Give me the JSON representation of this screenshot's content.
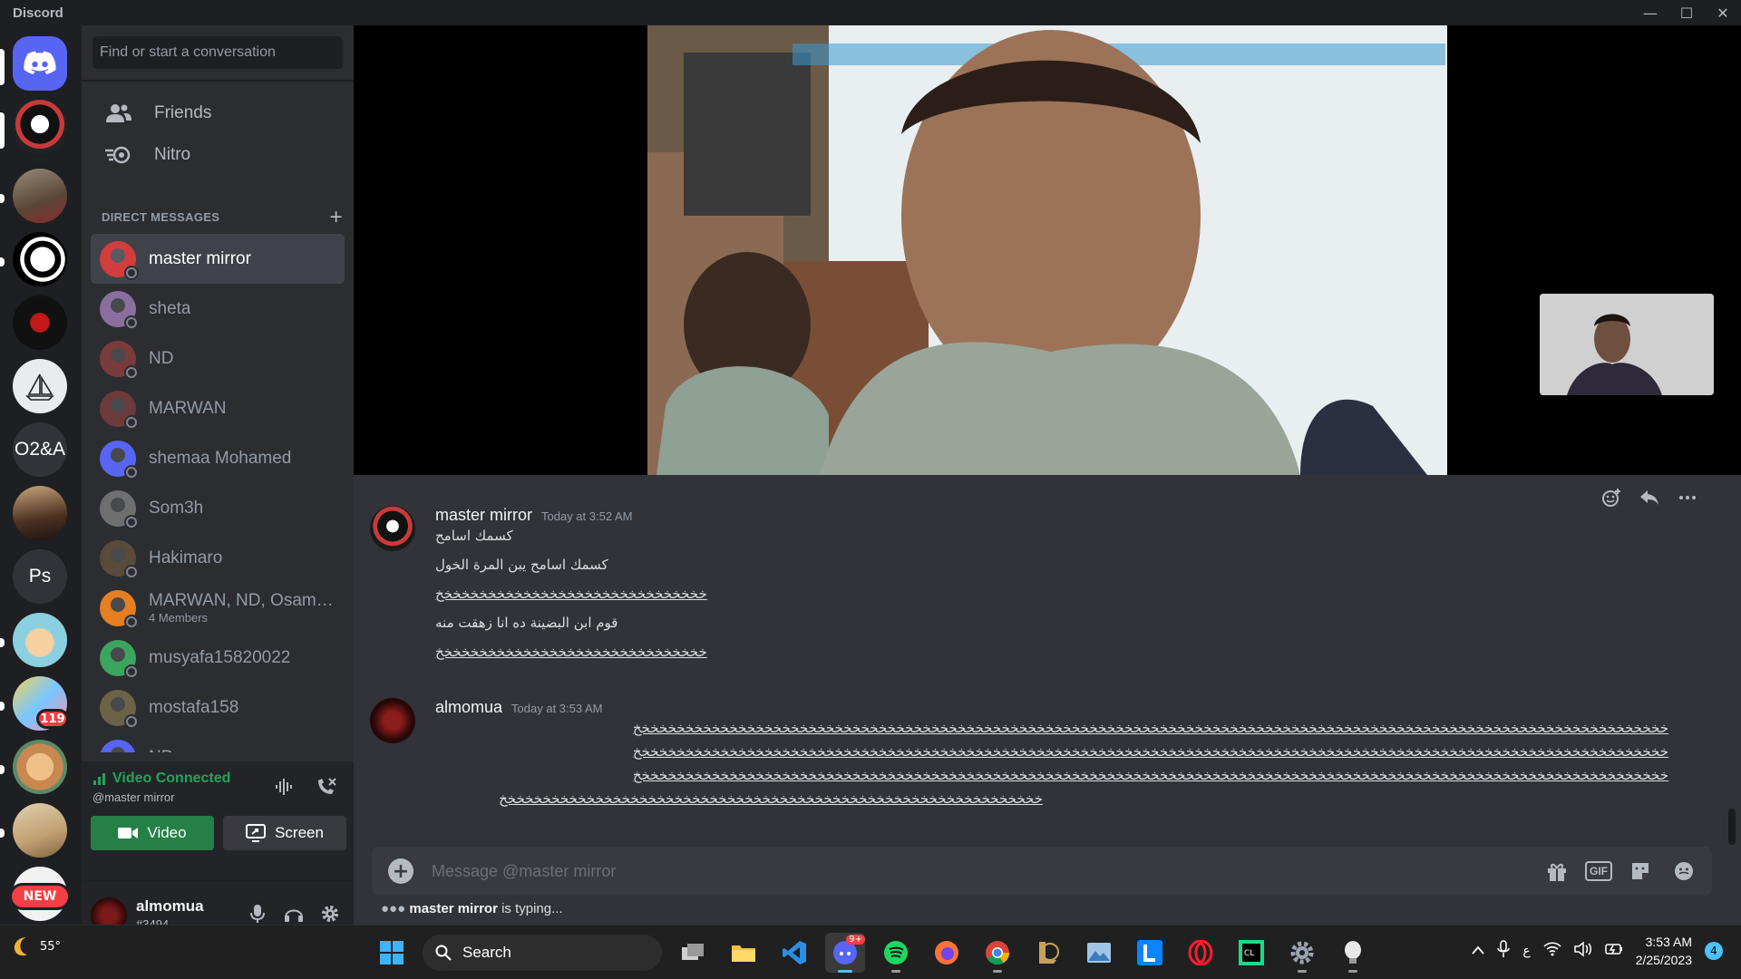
{
  "app": {
    "title": "Discord"
  },
  "window": {
    "minimize": "—",
    "maximize": "☐",
    "close": "✕"
  },
  "servers": [
    {
      "name": "discord-home",
      "label": ""
    },
    {
      "name": "penguin",
      "label": ""
    },
    {
      "name": "s3",
      "label": ""
    },
    {
      "name": "s4",
      "label": ""
    },
    {
      "name": "s5",
      "label": ""
    },
    {
      "name": "s6",
      "label": ""
    },
    {
      "name": "o2a",
      "label": "O2&A"
    },
    {
      "name": "s8",
      "label": ""
    },
    {
      "name": "ps",
      "label": "Ps"
    },
    {
      "name": "s10",
      "label": ""
    },
    {
      "name": "s11",
      "label": ""
    },
    {
      "name": "s12",
      "label": ""
    },
    {
      "name": "s13",
      "label": ""
    },
    {
      "name": "s14",
      "label": ""
    }
  ],
  "badges": {
    "count": "119",
    "new": "NEW"
  },
  "sidebar": {
    "search_placeholder": "Find or start a conversation",
    "friends": "Friends",
    "nitro": "Nitro",
    "dm_header": "DIRECT MESSAGES",
    "dm_add": "+",
    "dms": [
      {
        "name": "master mirror",
        "sub": "",
        "active": true,
        "color": "#d23d3d"
      },
      {
        "name": "sheta",
        "sub": "",
        "color": "#8a6f9e"
      },
      {
        "name": "ND",
        "sub": "",
        "color": "#7a3b3b"
      },
      {
        "name": "MARWAN",
        "sub": "",
        "color": "#6b3a3a"
      },
      {
        "name": "shemaa Mohamed",
        "sub": "",
        "color": "#5865f2"
      },
      {
        "name": "Som3h",
        "sub": "",
        "color": "#6f6f6f"
      },
      {
        "name": "Hakimaro",
        "sub": "",
        "color": "#5a4a3a"
      },
      {
        "name": "MARWAN, ND, Osama...",
        "sub": "4 Members",
        "color": "#e67e22"
      },
      {
        "name": "musyafa15820022",
        "sub": "",
        "color": "#3ba55d"
      },
      {
        "name": "mostafa158",
        "sub": "",
        "color": "#6b6345"
      },
      {
        "name": "ND",
        "sub": "",
        "color": "#5865f2"
      }
    ]
  },
  "voice": {
    "status": "Video Connected",
    "channel": "@master mirror",
    "video_label": "Video",
    "screen_label": "Screen"
  },
  "user": {
    "name": "almomua",
    "tag": "#3494"
  },
  "messages": [
    {
      "author": "master mirror",
      "time": "Today at 3:52 AM",
      "lines": [
        "كسمك اسامح",
        "كسمك اسامح يبن المرة الخول",
        "خخخخخخخخخخخخخخخخخخخخخخخخخخخخخخخ",
        "قوم ابن البضينة ده انا زهقت منه",
        "خخخخخخخخخخخخخخخخخخخخخخخخخخخخخخخ"
      ]
    },
    {
      "author": "almomua",
      "time": "Today at 3:53 AM",
      "lines": [
        "خخخخخخخخخخخخخخخخخخخخخخخخخخخخخخخخخخخخخخخخخخخخخخخخخخخخخخخخخخخخخخخخخخخخخخخخخخخخخخخخخخخخخخخخخخخخخخخخخخخخخخخخخخخخخخخخخخخخخخ",
        "خخخخخخخخخخخخخخخخخخخخخخخخخخخخخخخخخخخخخخخخخخخخخخخخخخخخخخخخخخخخخخخخخخخخخخخخخخخخخخخخخخخخخخخخخخخخخخخخخخخخخخخخخخخخخخخخخخخخخخ",
        "خخخخخخخخخخخخخخخخخخخخخخخخخخخخخخخخخخخخخخخخخخخخخخخخخخخخخخخخخخخخخخخخخخخخخخخخخخخخخخخخخخخخخخخخخخخخخخخخخخخخخخخخخخخخخخخخخخخخخخ",
        "خخخخخخخخخخخخخخخخخخخخخخخخخخخخخخخخخخخخخخخخخخخخخخخخخخخخخخخخخخخخخخ"
      ]
    }
  ],
  "composer": {
    "placeholder": "Message @master mirror",
    "gif": "GIF"
  },
  "typing": {
    "who": "master mirror",
    "text": " is typing..."
  },
  "taskbar": {
    "weather": "55°",
    "search": "Search",
    "discord_badge": "9+",
    "ime": "ع",
    "time": "3:53 AM",
    "date": "2/25/2023",
    "notifications": "4"
  },
  "colors": {
    "accent": "#5865f2",
    "online": "#23a55a",
    "danger": "#f23f43"
  }
}
